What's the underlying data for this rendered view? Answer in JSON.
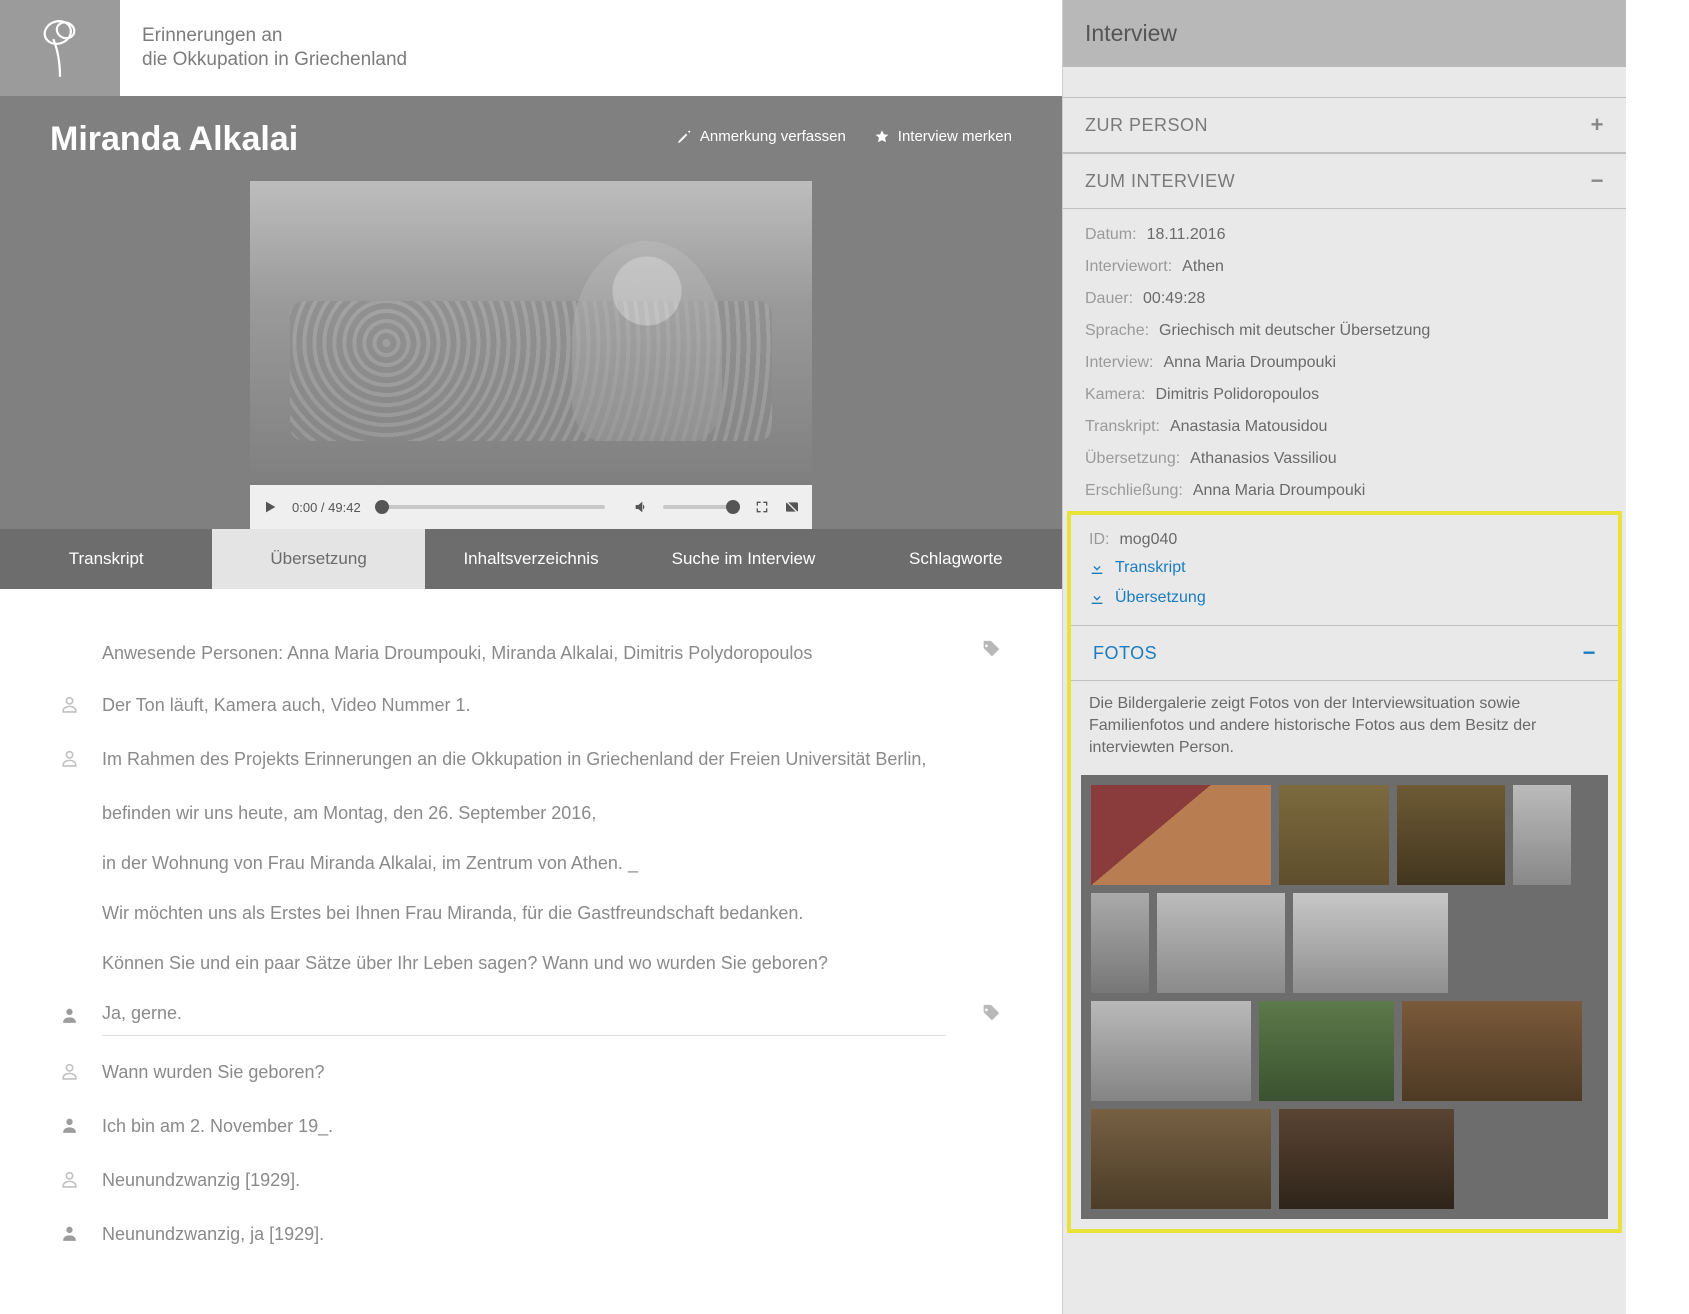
{
  "site": {
    "title_l1": "Erinnerungen an",
    "title_l2": "die Okkupation in Griechenland"
  },
  "hero": {
    "person_name": "Miranda Alkalai",
    "action_note": "Anmerkung verfassen",
    "action_bookmark": "Interview merken",
    "video": {
      "current": "0:00",
      "duration": "49:42"
    }
  },
  "tabs": {
    "transkript": "Transkript",
    "uebersetzung": "Übersetzung",
    "inhalt": "Inhaltsverzeichnis",
    "suche": "Suche im Interview",
    "schlagworte": "Schlagworte"
  },
  "transcript": {
    "note": "Anwesende Personen: Anna Maria Droumpouki, Miranda Alkalai, Dimitris Polydoropoulos",
    "l1": "Der Ton läuft, Kamera auch, Video Nummer 1.",
    "l2": "Im Rahmen des Projekts Erinnerungen an die Okkupation in Griechenland der Freien Universität Berlin,",
    "l2b": "befinden wir uns heute, am Montag, den 26. September 2016,",
    "l2c": "in der Wohnung von Frau Miranda Alkalai, im Zentrum von Athen. _",
    "l2d": "Wir möchten uns als Erstes bei Ihnen Frau Miranda, für die Gastfreundschaft bedanken.",
    "l2e": "Können Sie und ein paar Sätze über Ihr Leben sagen? Wann und wo wurden Sie geboren?",
    "l3": "Ja, gerne.",
    "l4": "Wann wurden Sie geboren?",
    "l5": "Ich bin am 2. November 19_.",
    "l6": "Neunundzwanzig [1929].",
    "l7": "Neunundzwanzig, ja [1929]."
  },
  "sidebar": {
    "title": "Interview",
    "zur_person": "ZUR PERSON",
    "zum_interview": "ZUM INTERVIEW",
    "fotos": "FOTOS",
    "fotos_desc": "Die Bildergalerie zeigt Fotos von der Interviewsituation sowie Familienfotos und andere historische Fotos aus dem Besitz der interviewten Person.",
    "meta": {
      "datum_k": "Datum:",
      "datum_v": "18.11.2016",
      "ort_k": "Interviewort:",
      "ort_v": "Athen",
      "dauer_k": "Dauer:",
      "dauer_v": "00:49:28",
      "sprache_k": "Sprache:",
      "sprache_v": "Griechisch mit deutscher Übersetzung",
      "interview_k": "Interview:",
      "interview_v": "Anna Maria Droumpouki",
      "kamera_k": "Kamera:",
      "kamera_v": "Dimitris Polidoropoulos",
      "transkript_k": "Transkript:",
      "transkript_v": "Anastasia Matousidou",
      "uebers_k": "Übersetzung:",
      "uebers_v": "Athanasios Vassiliou",
      "erschl_k": "Erschließung:",
      "erschl_v": "Anna Maria Droumpouki",
      "id_k": "ID:",
      "id_v": "mog040",
      "dl_transkript": "Transkript",
      "dl_uebersetzung": "Übersetzung"
    }
  }
}
